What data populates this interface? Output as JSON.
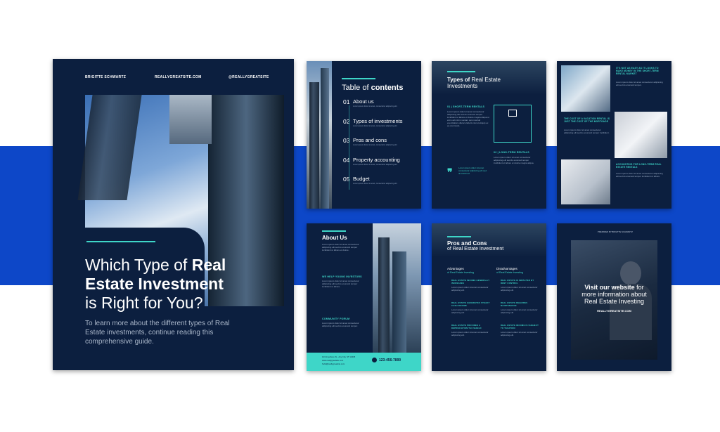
{
  "cover": {
    "author": "BRIGITTE SCHWARTZ",
    "site": "REALLYGREATSITE.COM",
    "handle": "@REALLYGREATSITE",
    "title_line1_plain": "Which Type of ",
    "title_line1_bold": "Real",
    "title_line2_bold": "Estate Investment",
    "title_line3": "is Right for You?",
    "subtitle": "To learn more about the different types of Real Estate investments, continue reading this comprehensive guide."
  },
  "toc": {
    "title_plain": "Table of ",
    "title_bold": "contents",
    "items": [
      {
        "num": "01",
        "label": "About us"
      },
      {
        "num": "02",
        "label": "Types of investments"
      },
      {
        "num": "03",
        "label": "Pros and cons"
      },
      {
        "num": "04",
        "label": "Property accounting"
      },
      {
        "num": "05",
        "label": "Budget"
      }
    ]
  },
  "types": {
    "title_bold": "Types of",
    "title_rest": " Real Estate Investments",
    "short_term": "01 | SHORT-TERM RENTALS",
    "long_term": "02 | LONG-TERM RENTALS"
  },
  "vacation": {
    "heading1": "IT'S NOT AS EASY AS IT LOOKS TO MAKE MONEY IN THE SHORT-TERM RENTAL MARKET",
    "heading2": "THE COST OF A VACATION RENTAL IS JUST THE COST OF THE MORTGAGE",
    "heading3": "ACCOUNTING FOR LONG-TERM REAL ESTATE RENTALS"
  },
  "about": {
    "title": "About Us",
    "sub1": "WE HELP YOUNG INVESTORS",
    "sub2": "COMMUNITY FORUM",
    "address": "123 Anywhere St., Any City, ST 12345",
    "site": "www.reallygreatsite.com",
    "email": "hello@reallygreatsite.com",
    "phone": "123-456-7890"
  },
  "pros": {
    "title": "Pros and Cons",
    "subtitle": "of Real Estate Investment",
    "adv": "Advantages",
    "adv_sub": "of Real Estate Investing",
    "dis": "Disadvantages",
    "dis_sub": "of Real Estate Investing",
    "adv_items": [
      "REAL ESTATE INCOME GENERALLY INCREASES",
      "REAL ESTATE GENERATES STEADY CASH INCOME",
      "REAL ESTATE PROVIDES A DEPRECIATION TAX SHIELD"
    ],
    "dis_items": [
      "REAL ESTATE IS IMPACTED BY RENT CONTROL",
      "REAL ESTATE REQUIRES MAINTENANCE",
      "REAL ESTATE INCOME IS SUBJECT TO TAXATION"
    ]
  },
  "visit": {
    "line1_bold": "Visit our website",
    "line1_rest": " for",
    "line2": "more information about",
    "line3": "Real Estate Investing",
    "url": "REALLYGREATSITE.COM",
    "top": "PREPARED BY BRIGITTE SCHWARTZ"
  },
  "colors": {
    "navy": "#0c1f3f",
    "teal": "#3ed6c8",
    "band": "#0d47c8"
  }
}
